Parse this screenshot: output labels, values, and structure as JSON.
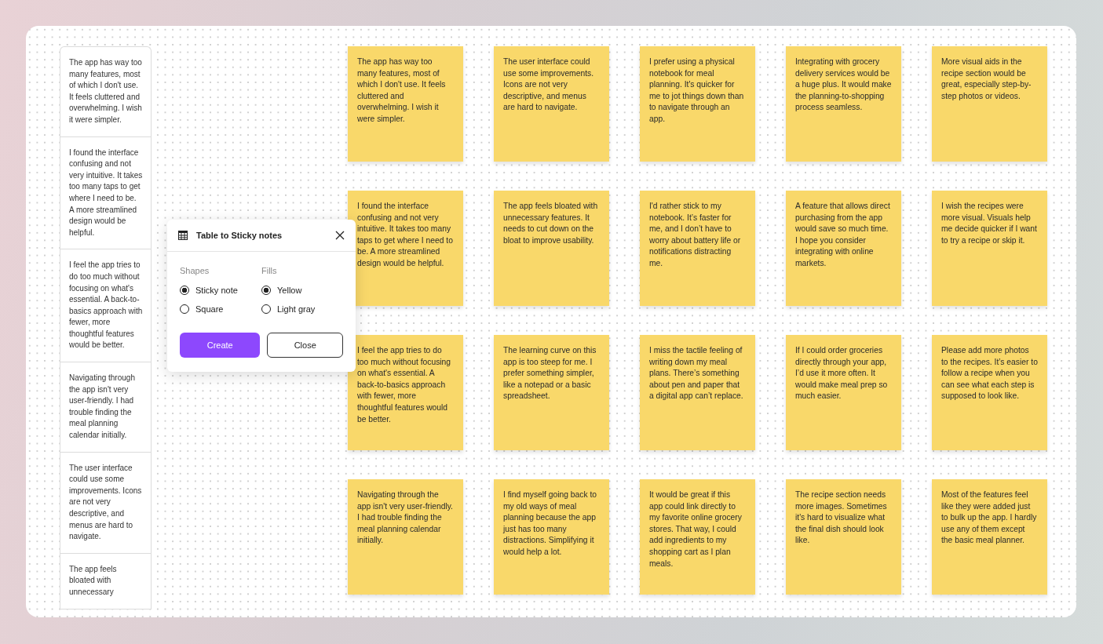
{
  "table": {
    "cells": [
      "The app has way too many features, most of which I don't use. It feels cluttered and overwhelming. I wish it were simpler.",
      "I found the interface confusing and not very intuitive. It takes too many taps to get where I need to be. A more streamlined design would be helpful.",
      "I feel the app tries to do too much without focusing on what's essential. A back-to-basics approach with fewer, more thoughtful features would be better.",
      "Navigating through the app isn't very user-friendly. I had trouble finding the meal planning calendar initially.",
      "The user interface could use some improvements. Icons are not very descriptive, and menus are hard to navigate.",
      "The app feels bloated with unnecessary"
    ]
  },
  "notes": [
    {
      "text": "The app has way too many features, most of which I don't use. It feels cluttered and overwhelming. I wish it were simpler."
    },
    {
      "text": "The user interface could use some improvements. Icons are not very descriptive, and menus are hard to navigate."
    },
    {
      "text": "I prefer using a physical notebook for meal planning. It's quicker for me to jot things down than to navigate through an app."
    },
    {
      "text": "Integrating with grocery delivery services would be a huge plus. It would make the planning-to-shopping process seamless."
    },
    {
      "text": "More visual aids in the recipe section would be great, especially step-by-step photos or videos."
    },
    {
      "text": "I found the interface confusing and not very intuitive. It takes too many taps to get where I need to be. A more streamlined design would be helpful."
    },
    {
      "text": "The app feels bloated with unnecessary features. It needs to cut down on the bloat to improve usability."
    },
    {
      "text": "I'd rather stick to my notebook. It’s faster for me, and I don’t have to worry about battery life or notifications distracting me."
    },
    {
      "text": "A feature that allows direct purchasing from the app would save so much time. I hope you consider integrating with online markets."
    },
    {
      "text": "I wish the recipes were more visual. Visuals help me decide quicker if I want to try a recipe or skip it."
    },
    {
      "text": "I feel the app tries to do too much without focusing on what's essential. A back-to-basics approach with fewer, more thoughtful features would be better."
    },
    {
      "text": "The learning curve on this app is too steep for me. I prefer something simpler, like a notepad or a basic spreadsheet."
    },
    {
      "text": "I miss the tactile feeling of writing down my meal plans. There’s something about pen and paper that a digital app can’t replace."
    },
    {
      "text": "If I could order groceries directly through your app, I’d use it more often. It would make meal prep so much easier."
    },
    {
      "text": "Please add more photos to the recipes. It’s easier to follow a recipe when you can see what each step is supposed to look like."
    },
    {
      "text": "Navigating through the app isn't very user-friendly. I had trouble finding the meal planning calendar initially."
    },
    {
      "text": "I find myself going back to my old ways of meal planning because the app just has too many distractions. Simplifying it would help a lot."
    },
    {
      "text": "It would be great if this app could link directly to my favorite online grocery stores. That way, I could add ingredients to my shopping cart as I plan meals."
    },
    {
      "text": "The recipe section needs more images. Sometimes it's hard to visualize what the final dish should look like."
    },
    {
      "text": "Most of the features feel like they were added just to bulk up the app. I hardly use any of them except the basic meal planner."
    }
  ],
  "dialog": {
    "title": "Table to Sticky notes",
    "groups": [
      {
        "label": "Shapes",
        "options": [
          {
            "label": "Sticky note",
            "selected": true
          },
          {
            "label": "Square",
            "selected": false
          }
        ]
      },
      {
        "label": "Fills",
        "options": [
          {
            "label": "Yellow",
            "selected": true
          },
          {
            "label": "Light gray",
            "selected": false
          }
        ]
      }
    ],
    "buttons": [
      {
        "label": "Create",
        "kind": "primary"
      },
      {
        "label": "Close",
        "kind": "secondary"
      }
    ]
  }
}
